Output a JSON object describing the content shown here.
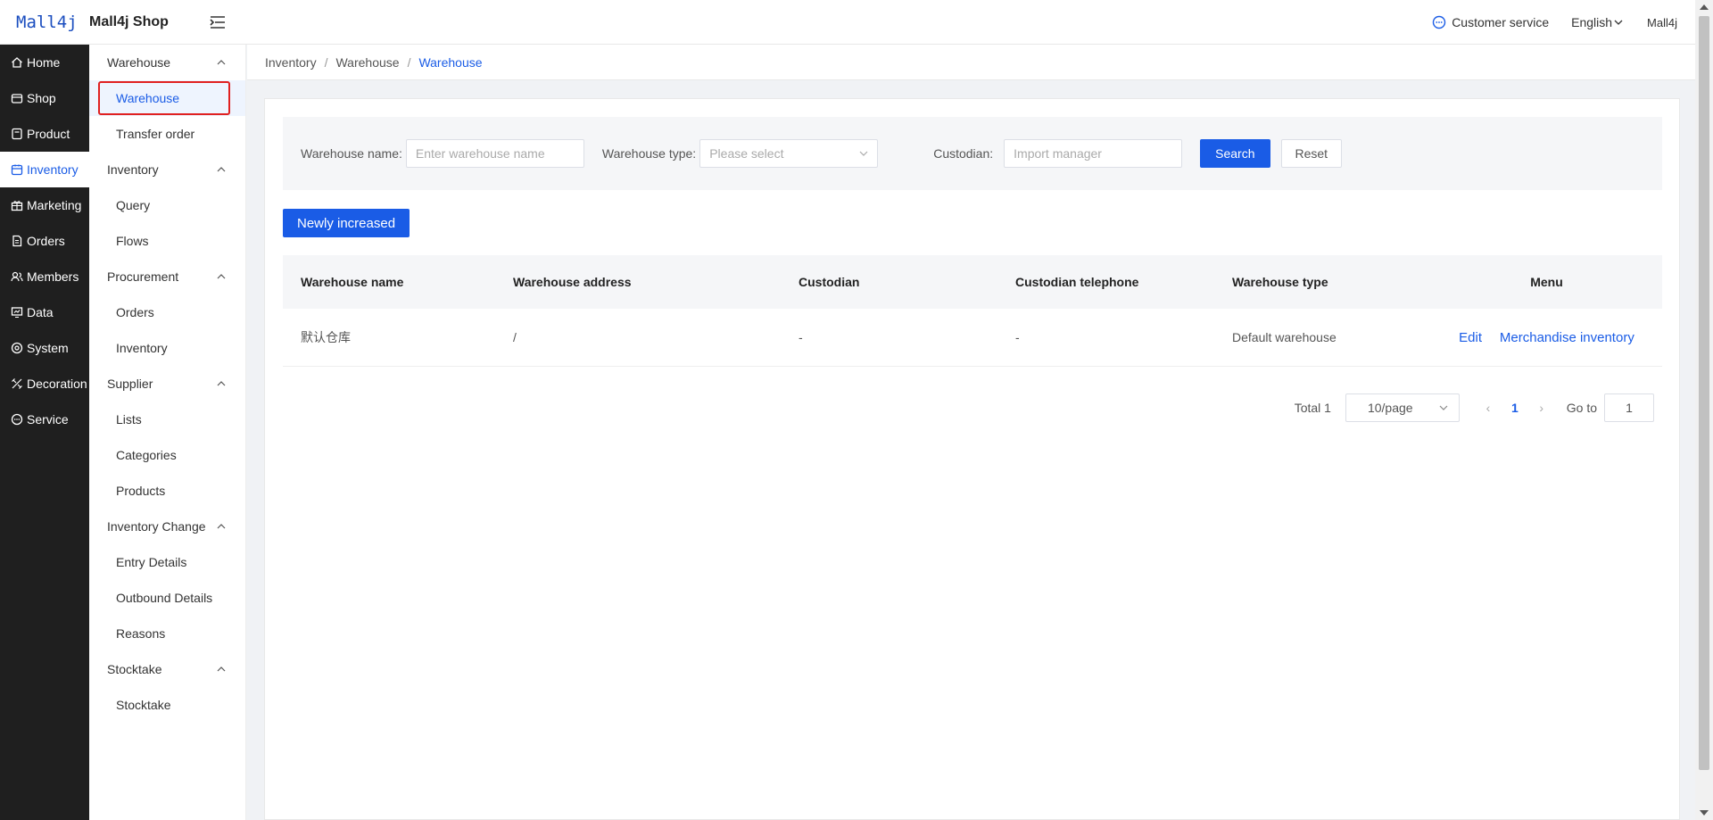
{
  "header": {
    "logo": "Mall4j",
    "shop_name": "Mall4j Shop",
    "customer_service": "Customer service",
    "language": "English",
    "user": "Mall4j"
  },
  "main_nav": [
    {
      "label": "Home",
      "icon": "home-icon"
    },
    {
      "label": "Shop",
      "icon": "shop-icon"
    },
    {
      "label": "Product",
      "icon": "product-icon"
    },
    {
      "label": "Inventory",
      "icon": "inventory-icon",
      "active": true
    },
    {
      "label": "Marketing",
      "icon": "marketing-icon"
    },
    {
      "label": "Orders",
      "icon": "orders-icon"
    },
    {
      "label": "Members",
      "icon": "members-icon"
    },
    {
      "label": "Data",
      "icon": "data-icon"
    },
    {
      "label": "System",
      "icon": "system-icon"
    },
    {
      "label": "Decoration",
      "icon": "decoration-icon"
    },
    {
      "label": "Service",
      "icon": "service-icon"
    }
  ],
  "sub_nav": {
    "groups": [
      {
        "label": "Warehouse",
        "items": [
          "Warehouse",
          "Transfer order"
        ]
      },
      {
        "label": "Inventory",
        "items": [
          "Query",
          "Flows"
        ]
      },
      {
        "label": "Procurement",
        "items": [
          "Orders",
          "Inventory"
        ]
      },
      {
        "label": "Supplier",
        "items": [
          "Lists",
          "Categories",
          "Products"
        ]
      },
      {
        "label": "Inventory Change",
        "items": [
          "Entry Details",
          "Outbound Details",
          "Reasons"
        ]
      },
      {
        "label": "Stocktake",
        "items": [
          "Stocktake"
        ]
      }
    ]
  },
  "breadcrumb": [
    "Inventory",
    "Warehouse",
    "Warehouse"
  ],
  "filter": {
    "name_label": "Warehouse name:",
    "name_placeholder": "Enter warehouse name",
    "type_label": "Warehouse type:",
    "type_placeholder": "Please select",
    "custodian_label": "Custodian:",
    "custodian_placeholder": "Import manager",
    "search": "Search",
    "reset": "Reset"
  },
  "new_button": "Newly increased",
  "table": {
    "headers": [
      "Warehouse name",
      "Warehouse address",
      "Custodian",
      "Custodian telephone",
      "Warehouse type",
      "Menu"
    ],
    "rows": [
      {
        "name": "默认仓库",
        "address": "/",
        "custodian": "-",
        "telephone": "-",
        "type": "Default warehouse",
        "actions": [
          "Edit",
          "Merchandise inventory"
        ]
      }
    ]
  },
  "pagination": {
    "total": "Total 1",
    "page_size": "10/page",
    "current": "1",
    "goto_label": "Go to",
    "goto_value": "1"
  },
  "colors": {
    "accent": "#1a5ce6",
    "sidebar": "#1f1f1f",
    "highlight": "#e02020"
  }
}
